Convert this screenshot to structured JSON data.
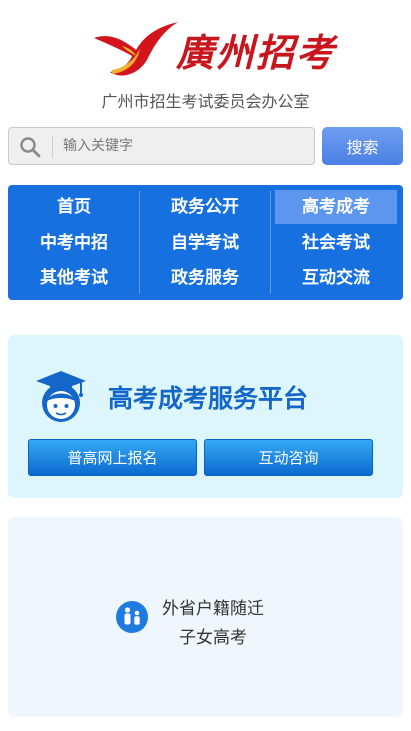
{
  "header": {
    "logo_text": "廣州招考",
    "org_name": "广州市招生考试委员会办公室",
    "brand_color": "#c8161e"
  },
  "search": {
    "placeholder": "输入关键字",
    "button_label": "搜索",
    "icon": "search-icon"
  },
  "nav": {
    "items": [
      {
        "label": "首页"
      },
      {
        "label": "政务公开"
      },
      {
        "label": "高考成考"
      },
      {
        "label": "中考中招"
      },
      {
        "label": "自学考试"
      },
      {
        "label": "社会考试"
      },
      {
        "label": "其他考试"
      },
      {
        "label": "政务服务"
      },
      {
        "label": "互动交流"
      }
    ],
    "active": "高考成考",
    "background_color": "#1670e0"
  },
  "service_card": {
    "title": "高考成考服务平台",
    "icon": "graduate-icon",
    "buttons": [
      {
        "label": "普高网上报名"
      },
      {
        "label": "互动咨询"
      }
    ]
  },
  "migrant_card": {
    "icon": "family-icon",
    "line1": "外省户籍随迁",
    "line2": "子女高考"
  }
}
